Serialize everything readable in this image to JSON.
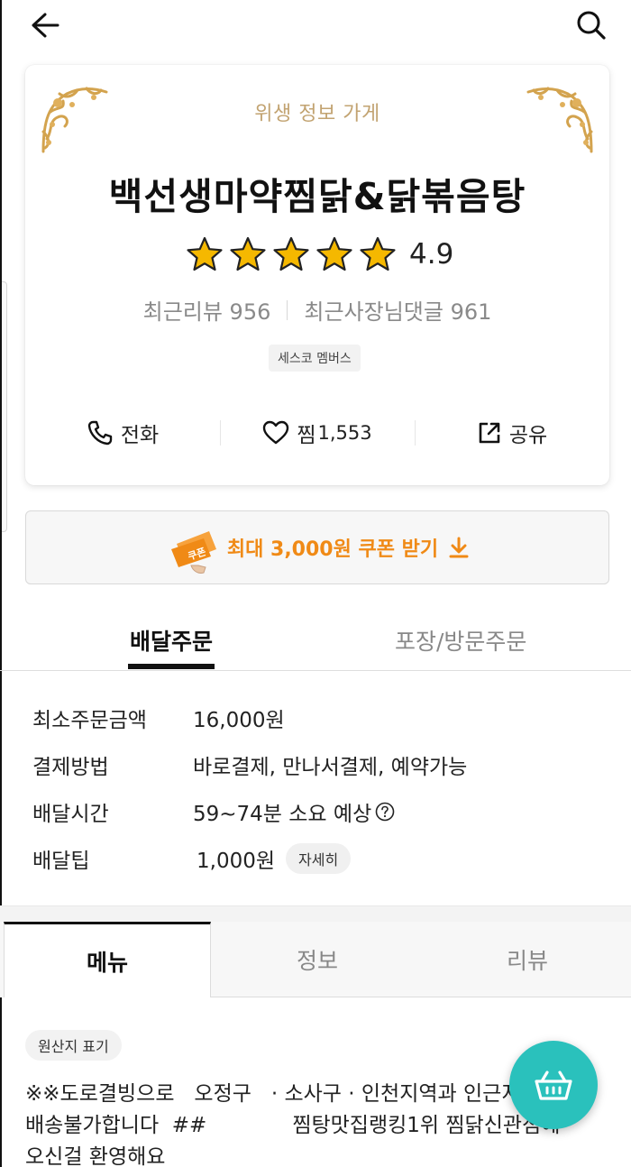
{
  "header": {
    "back_icon": "arrow-left-icon",
    "search_icon": "search-icon"
  },
  "store": {
    "hygiene_label": "위생 정보 가게",
    "name": "백선생마약찜닭&닭볶음탕",
    "rating": "4.9",
    "stars_filled": 5,
    "stars_total": 5,
    "recent_reviews": "최근리뷰 956",
    "owner_replies": "최근사장님댓글 961",
    "badge": "세스코 멤버스",
    "actions": {
      "call_label": "전화",
      "like_label": "찜",
      "like_count": "1,553",
      "share_label": "공유"
    }
  },
  "coupon": {
    "text": "최대 3,000원 쿠폰 받기",
    "icon_label": "쿠폰"
  },
  "order_tabs": {
    "delivery": "배달주문",
    "pickup": "포장/방문주문"
  },
  "delivery_info": {
    "min_order_label": "최소주문금액",
    "min_order_value": "16,000원",
    "payment_label": "결제방법",
    "payment_value": "바로결제, 만나서결제, 예약가능",
    "time_label": "배달시간",
    "time_value": "59~74분 소요 예상",
    "tip_label": "배달팁",
    "tip_value": "1,000원",
    "tip_detail": "자세히"
  },
  "content_tabs": {
    "menu": "메뉴",
    "info": "정보",
    "review": "리뷰"
  },
  "menu": {
    "origin_chip": "원산지 표기",
    "notice": "※※도로결빙으로   오정구   · 소사구 · 인천지역과 인근지역은\n배송불가합니다  ##             찜탕맛집랭킹1위 찜닭신관점에\n오신걸 환영해요"
  },
  "colors": {
    "accent_mint": "#2ac1bc",
    "coupon_orange": "#f08a16",
    "hygiene_gold": "#c2a371",
    "star_gold": "#f5b800"
  }
}
